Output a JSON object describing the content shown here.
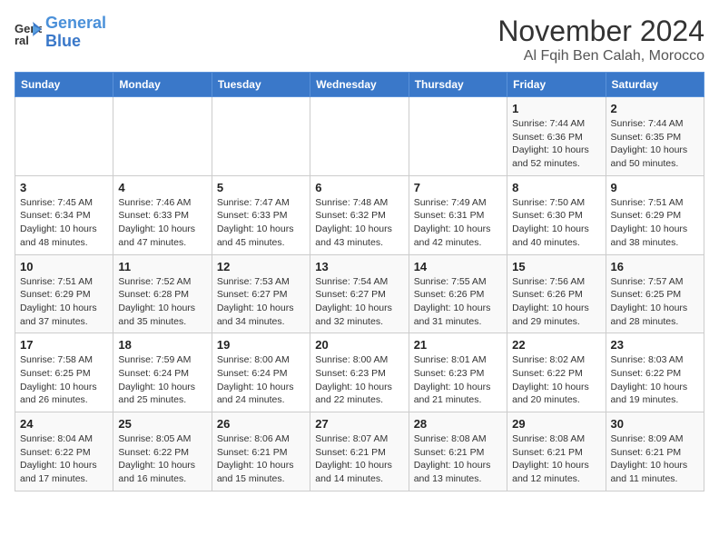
{
  "header": {
    "logo_text_general": "General",
    "logo_text_blue": "Blue",
    "month_title": "November 2024",
    "location": "Al Fqih Ben Calah, Morocco"
  },
  "days_of_week": [
    "Sunday",
    "Monday",
    "Tuesday",
    "Wednesday",
    "Thursday",
    "Friday",
    "Saturday"
  ],
  "weeks": [
    [
      {
        "day": "",
        "detail": ""
      },
      {
        "day": "",
        "detail": ""
      },
      {
        "day": "",
        "detail": ""
      },
      {
        "day": "",
        "detail": ""
      },
      {
        "day": "",
        "detail": ""
      },
      {
        "day": "1",
        "detail": "Sunrise: 7:44 AM\nSunset: 6:36 PM\nDaylight: 10 hours and 52 minutes."
      },
      {
        "day": "2",
        "detail": "Sunrise: 7:44 AM\nSunset: 6:35 PM\nDaylight: 10 hours and 50 minutes."
      }
    ],
    [
      {
        "day": "3",
        "detail": "Sunrise: 7:45 AM\nSunset: 6:34 PM\nDaylight: 10 hours and 48 minutes."
      },
      {
        "day": "4",
        "detail": "Sunrise: 7:46 AM\nSunset: 6:33 PM\nDaylight: 10 hours and 47 minutes."
      },
      {
        "day": "5",
        "detail": "Sunrise: 7:47 AM\nSunset: 6:33 PM\nDaylight: 10 hours and 45 minutes."
      },
      {
        "day": "6",
        "detail": "Sunrise: 7:48 AM\nSunset: 6:32 PM\nDaylight: 10 hours and 43 minutes."
      },
      {
        "day": "7",
        "detail": "Sunrise: 7:49 AM\nSunset: 6:31 PM\nDaylight: 10 hours and 42 minutes."
      },
      {
        "day": "8",
        "detail": "Sunrise: 7:50 AM\nSunset: 6:30 PM\nDaylight: 10 hours and 40 minutes."
      },
      {
        "day": "9",
        "detail": "Sunrise: 7:51 AM\nSunset: 6:29 PM\nDaylight: 10 hours and 38 minutes."
      }
    ],
    [
      {
        "day": "10",
        "detail": "Sunrise: 7:51 AM\nSunset: 6:29 PM\nDaylight: 10 hours and 37 minutes."
      },
      {
        "day": "11",
        "detail": "Sunrise: 7:52 AM\nSunset: 6:28 PM\nDaylight: 10 hours and 35 minutes."
      },
      {
        "day": "12",
        "detail": "Sunrise: 7:53 AM\nSunset: 6:27 PM\nDaylight: 10 hours and 34 minutes."
      },
      {
        "day": "13",
        "detail": "Sunrise: 7:54 AM\nSunset: 6:27 PM\nDaylight: 10 hours and 32 minutes."
      },
      {
        "day": "14",
        "detail": "Sunrise: 7:55 AM\nSunset: 6:26 PM\nDaylight: 10 hours and 31 minutes."
      },
      {
        "day": "15",
        "detail": "Sunrise: 7:56 AM\nSunset: 6:26 PM\nDaylight: 10 hours and 29 minutes."
      },
      {
        "day": "16",
        "detail": "Sunrise: 7:57 AM\nSunset: 6:25 PM\nDaylight: 10 hours and 28 minutes."
      }
    ],
    [
      {
        "day": "17",
        "detail": "Sunrise: 7:58 AM\nSunset: 6:25 PM\nDaylight: 10 hours and 26 minutes."
      },
      {
        "day": "18",
        "detail": "Sunrise: 7:59 AM\nSunset: 6:24 PM\nDaylight: 10 hours and 25 minutes."
      },
      {
        "day": "19",
        "detail": "Sunrise: 8:00 AM\nSunset: 6:24 PM\nDaylight: 10 hours and 24 minutes."
      },
      {
        "day": "20",
        "detail": "Sunrise: 8:00 AM\nSunset: 6:23 PM\nDaylight: 10 hours and 22 minutes."
      },
      {
        "day": "21",
        "detail": "Sunrise: 8:01 AM\nSunset: 6:23 PM\nDaylight: 10 hours and 21 minutes."
      },
      {
        "day": "22",
        "detail": "Sunrise: 8:02 AM\nSunset: 6:22 PM\nDaylight: 10 hours and 20 minutes."
      },
      {
        "day": "23",
        "detail": "Sunrise: 8:03 AM\nSunset: 6:22 PM\nDaylight: 10 hours and 19 minutes."
      }
    ],
    [
      {
        "day": "24",
        "detail": "Sunrise: 8:04 AM\nSunset: 6:22 PM\nDaylight: 10 hours and 17 minutes."
      },
      {
        "day": "25",
        "detail": "Sunrise: 8:05 AM\nSunset: 6:22 PM\nDaylight: 10 hours and 16 minutes."
      },
      {
        "day": "26",
        "detail": "Sunrise: 8:06 AM\nSunset: 6:21 PM\nDaylight: 10 hours and 15 minutes."
      },
      {
        "day": "27",
        "detail": "Sunrise: 8:07 AM\nSunset: 6:21 PM\nDaylight: 10 hours and 14 minutes."
      },
      {
        "day": "28",
        "detail": "Sunrise: 8:08 AM\nSunset: 6:21 PM\nDaylight: 10 hours and 13 minutes."
      },
      {
        "day": "29",
        "detail": "Sunrise: 8:08 AM\nSunset: 6:21 PM\nDaylight: 10 hours and 12 minutes."
      },
      {
        "day": "30",
        "detail": "Sunrise: 8:09 AM\nSunset: 6:21 PM\nDaylight: 10 hours and 11 minutes."
      }
    ]
  ]
}
